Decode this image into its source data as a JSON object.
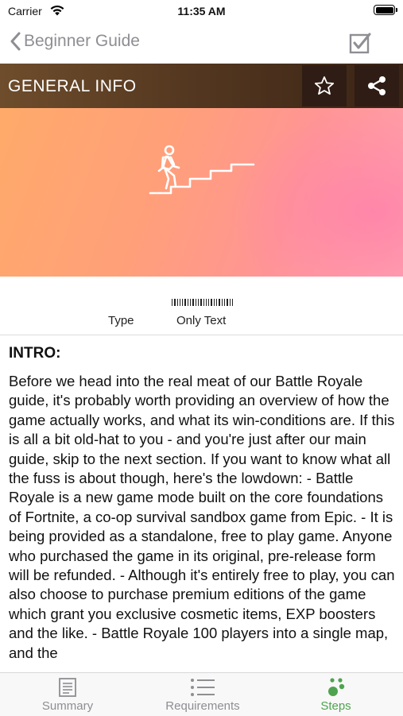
{
  "status_bar": {
    "carrier": "Carrier",
    "time": "11:35 AM"
  },
  "nav": {
    "back_label": "Beginner Guide"
  },
  "section": {
    "title": "GENERAL INFO"
  },
  "meta": {
    "type_label": "Type",
    "type_value": "Only Text"
  },
  "intro": {
    "title": "INTRO:",
    "body": "Before we head into the real meat of our Battle Royale guide, it's probably worth providing an overview of how the game actually works, and what its win-conditions are. If this is all a bit old-hat to you - and you're just after our main guide, skip to the next section. If you want to know what all the fuss is about though, here's the lowdown: - Battle Royale is a new game mode built on the core foundations of Fortnite, a co-op survival sandbox game from Epic. - It is being provided as a standalone, free to play game. Anyone who purchased the game in its original, pre-release form will be refunded. - Although it's entirely free to play, you can also choose to purchase premium editions of the game which grant you exclusive cosmetic items, EXP boosters and the like. - Battle Royale 100 players into a single map, and the"
  },
  "tabs": [
    {
      "label": "Summary",
      "icon": "document-icon",
      "active": false
    },
    {
      "label": "Requirements",
      "icon": "star-list-icon",
      "active": false
    },
    {
      "label": "Steps",
      "icon": "steps-dots-icon",
      "active": true
    }
  ],
  "colors": {
    "active_tab": "#4fa34f",
    "inactive": "#8e8e93",
    "header_dark": "#2f1c14"
  }
}
